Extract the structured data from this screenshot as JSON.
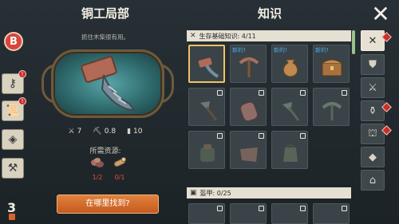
{
  "workshop": {
    "title": "铜工局部",
    "hint": "抓住木柴很有用。",
    "stats": [
      {
        "icon": "sword-icon",
        "value": "7"
      },
      {
        "icon": "pickaxe-icon",
        "value": "0.8"
      },
      {
        "icon": "durability-icon",
        "value": "10"
      }
    ],
    "requirements_title": "所需资源:",
    "requirements": [
      {
        "name": "copper-ore",
        "count": "1/2"
      },
      {
        "name": "log",
        "count": "0/1"
      }
    ],
    "find_button": "在哪里找到?"
  },
  "left_strip": {
    "badge": "B",
    "level": "3",
    "notifications": [
      "!",
      "!",
      "!"
    ]
  },
  "knowledge": {
    "title": "知识",
    "categories": [
      {
        "label": "生存基础知识: 4/11"
      },
      {
        "label": "盔甲: 0/25"
      }
    ],
    "new_label": "新的!",
    "items": [
      {
        "name": "copper-hammer",
        "state": "selected",
        "new": false,
        "locked": false
      },
      {
        "name": "pickaxe",
        "state": "normal",
        "new": true,
        "locked": false
      },
      {
        "name": "sack",
        "state": "normal",
        "new": true,
        "locked": false
      },
      {
        "name": "chest",
        "state": "normal",
        "new": true,
        "locked": false
      },
      {
        "name": "axe",
        "state": "locked",
        "new": false,
        "locked": true
      },
      {
        "name": "barrel",
        "state": "locked",
        "new": false,
        "locked": true
      },
      {
        "name": "stone-axe",
        "state": "locked",
        "new": false,
        "locked": true
      },
      {
        "name": "stone-pick",
        "state": "locked",
        "new": false,
        "locked": true
      },
      {
        "name": "backpack",
        "state": "locked",
        "new": false,
        "locked": true
      },
      {
        "name": "leather",
        "state": "locked",
        "new": false,
        "locked": true
      },
      {
        "name": "bag",
        "state": "locked",
        "new": false,
        "locked": true
      }
    ]
  },
  "tabs": [
    {
      "name": "survival",
      "active": true,
      "badge": true
    },
    {
      "name": "armor",
      "active": false,
      "badge": false
    },
    {
      "name": "weapons",
      "active": false,
      "badge": false
    },
    {
      "name": "potions",
      "active": false,
      "badge": true
    },
    {
      "name": "building",
      "active": false,
      "badge": true
    },
    {
      "name": "crafting",
      "active": false,
      "badge": false
    },
    {
      "name": "home",
      "active": false,
      "badge": false
    }
  ],
  "colors": {
    "accent": "#e0823d",
    "new_label": "#4fa8e6",
    "missing": "#e74b3c",
    "selected_border": "#f3c163"
  }
}
